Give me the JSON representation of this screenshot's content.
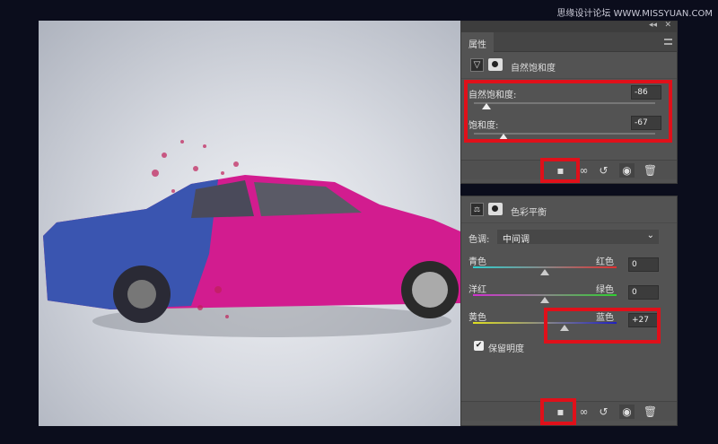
{
  "watermark": "思缘设计论坛  WWW.MISSYUAN.COM",
  "panel_top": {
    "collapse_label": "◂◂",
    "close_label": "✕",
    "tab": "属性",
    "title": "自然饱和度",
    "vibrance": {
      "label": "自然饱和度:",
      "value": "-86",
      "slider_fraction": 0.07
    },
    "saturation": {
      "label": "饱和度:",
      "value": "-67",
      "slider_fraction": 0.165
    }
  },
  "panel_bottom": {
    "title": "色彩平衡",
    "tone_label": "色调:",
    "tone_value": "中间调",
    "sliders": [
      {
        "left": "青色",
        "right": "红色",
        "value": "0",
        "fraction": 0.5,
        "gradient": [
          "#2fd0d0",
          "#e03030"
        ]
      },
      {
        "left": "洋红",
        "right": "绿色",
        "value": "0",
        "fraction": 0.5,
        "gradient": [
          "#d030d0",
          "#30d030"
        ]
      },
      {
        "left": "黄色",
        "right": "蓝色",
        "value": "+27",
        "fraction": 0.635,
        "gradient": [
          "#e0e020",
          "#2020c0"
        ]
      }
    ],
    "preserve_label": "保留明度",
    "preserve_checked": true
  },
  "colors": {
    "highlight": "#e0101a",
    "panel": "#535353"
  }
}
